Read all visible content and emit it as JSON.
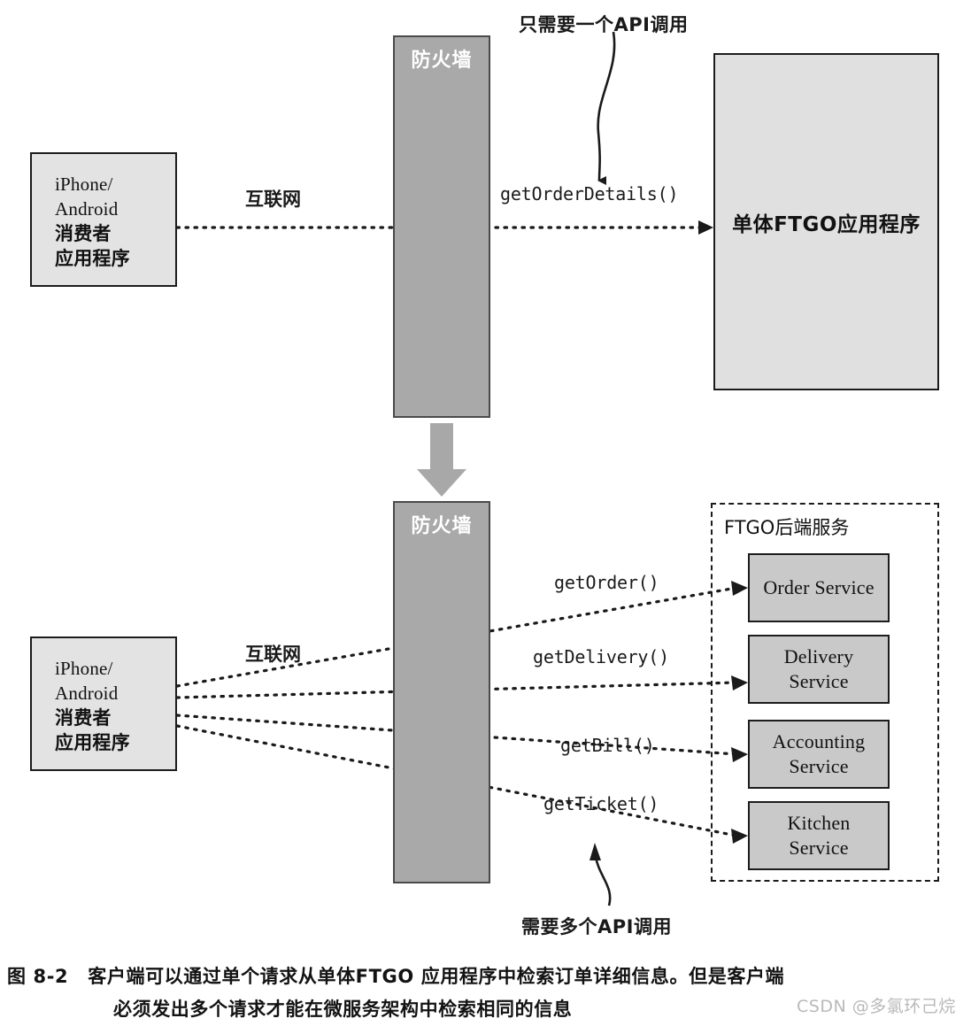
{
  "figure": {
    "caption_number": "图 8-2",
    "caption_line1": "客户端可以通过单个请求从单体FTGO 应用程序中检索订单详细信息。但是客户端",
    "caption_line2": "必须发出多个请求才能在微服务架构中检索相同的信息",
    "watermark": "CSDN @多氯环己烷"
  },
  "top_section": {
    "annotation": "只需要一个API调用",
    "network_label": "互联网",
    "api_call": "getOrderDetails()",
    "client": {
      "line1": "iPhone/",
      "line2": "Android",
      "line3": "消费者",
      "line4": "应用程序"
    },
    "firewall_label": "防火墙",
    "monolith_label": "单体FTGO应用程序"
  },
  "bottom_section": {
    "annotation": "需要多个API调用",
    "network_label": "互联网",
    "client": {
      "line1": "iPhone/",
      "line2": "Android",
      "line3": "消费者",
      "line4": "应用程序"
    },
    "firewall_label": "防火墙",
    "services_container_label": "FTGO后端服务",
    "api_calls": [
      "getOrder()",
      "getDelivery()",
      "getBill()",
      "getTicket()"
    ],
    "services": [
      {
        "line1": "Order Service",
        "line2": ""
      },
      {
        "line1": "Delivery",
        "line2": "Service"
      },
      {
        "line1": "Accounting",
        "line2": "Service"
      },
      {
        "line1": "Kitchen",
        "line2": "Service"
      }
    ]
  },
  "colors": {
    "box_fill": "#e2e2e2",
    "firewall_fill": "#a9a9a9",
    "service_fill": "#c9c9c9",
    "stroke": "#1c1c1c",
    "transition_arrow": "#a8a8a8",
    "watermark": "#b9b9b9"
  }
}
